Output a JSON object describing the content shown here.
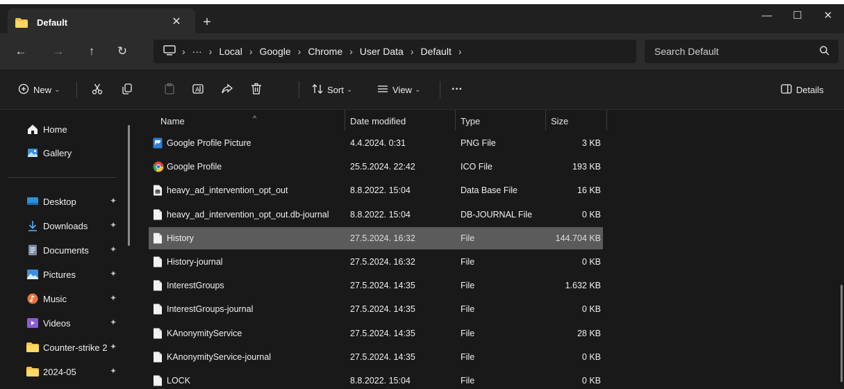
{
  "window": {
    "tab_title": "Default",
    "tab_close": "✕",
    "new_tab": "+",
    "minimize": "—",
    "maximize": "☐",
    "close": "✕"
  },
  "nav": {
    "back": "←",
    "forward": "→",
    "up": "↑",
    "refresh": "↻",
    "overflow": "···",
    "breadcrumb": [
      "Local",
      "Google",
      "Chrome",
      "User Data",
      "Default"
    ],
    "separator": "›",
    "search_placeholder": "Search Default"
  },
  "toolbar": {
    "new_label": "New",
    "sort_label": "Sort",
    "view_label": "View",
    "more": "···",
    "details_label": "Details",
    "chev": "⌄"
  },
  "sidebar": {
    "items": [
      {
        "label": "Home",
        "icon": "home-icon",
        "pinned": false
      },
      {
        "label": "Gallery",
        "icon": "gallery-icon",
        "pinned": false
      },
      {
        "label": "Desktop",
        "icon": "desktop-icon",
        "pinned": true
      },
      {
        "label": "Downloads",
        "icon": "download-icon",
        "pinned": true
      },
      {
        "label": "Documents",
        "icon": "documents-icon",
        "pinned": true
      },
      {
        "label": "Pictures",
        "icon": "pictures-icon",
        "pinned": true
      },
      {
        "label": "Music",
        "icon": "music-icon",
        "pinned": true
      },
      {
        "label": "Videos",
        "icon": "videos-icon",
        "pinned": true
      },
      {
        "label": "Counter-strike 2",
        "icon": "folder-icon",
        "pinned": true
      },
      {
        "label": "2024-05",
        "icon": "folder-icon",
        "pinned": true
      }
    ],
    "pin_glyph": "📌"
  },
  "columns": {
    "name": "Name",
    "date": "Date modified",
    "type": "Type",
    "size": "Size"
  },
  "files": [
    {
      "name": "Google Profile Picture",
      "date": "4.4.2024. 0:31",
      "type": "PNG File",
      "size": "3 KB",
      "icon": "image-file-icon"
    },
    {
      "name": "Google Profile",
      "date": "25.5.2024. 22:42",
      "type": "ICO File",
      "size": "193 KB",
      "icon": "chrome-icon"
    },
    {
      "name": "heavy_ad_intervention_opt_out",
      "date": "8.8.2022. 15:04",
      "type": "Data Base File",
      "size": "16 KB",
      "icon": "database-file-icon"
    },
    {
      "name": "heavy_ad_intervention_opt_out.db-journal",
      "date": "8.8.2022. 15:04",
      "type": "DB-JOURNAL File",
      "size": "0 KB",
      "icon": "file-icon"
    },
    {
      "name": "History",
      "date": "27.5.2024. 16:32",
      "type": "File",
      "size": "144.704 KB",
      "icon": "file-icon",
      "selected": true
    },
    {
      "name": "History-journal",
      "date": "27.5.2024. 16:32",
      "type": "File",
      "size": "0 KB",
      "icon": "file-icon"
    },
    {
      "name": "InterestGroups",
      "date": "27.5.2024. 14:35",
      "type": "File",
      "size": "1.632 KB",
      "icon": "file-icon"
    },
    {
      "name": "InterestGroups-journal",
      "date": "27.5.2024. 14:35",
      "type": "File",
      "size": "0 KB",
      "icon": "file-icon"
    },
    {
      "name": "KAnonymityService",
      "date": "27.5.2024. 14:35",
      "type": "File",
      "size": "28 KB",
      "icon": "file-icon"
    },
    {
      "name": "KAnonymityService-journal",
      "date": "27.5.2024. 14:35",
      "type": "File",
      "size": "0 KB",
      "icon": "file-icon"
    },
    {
      "name": "LOCK",
      "date": "8.8.2022. 15:04",
      "type": "File",
      "size": "0 KB",
      "icon": "file-icon"
    }
  ],
  "colors": {
    "accent_folder": "#f5c342",
    "selection": "#5b5b5b",
    "background": "#191919"
  }
}
